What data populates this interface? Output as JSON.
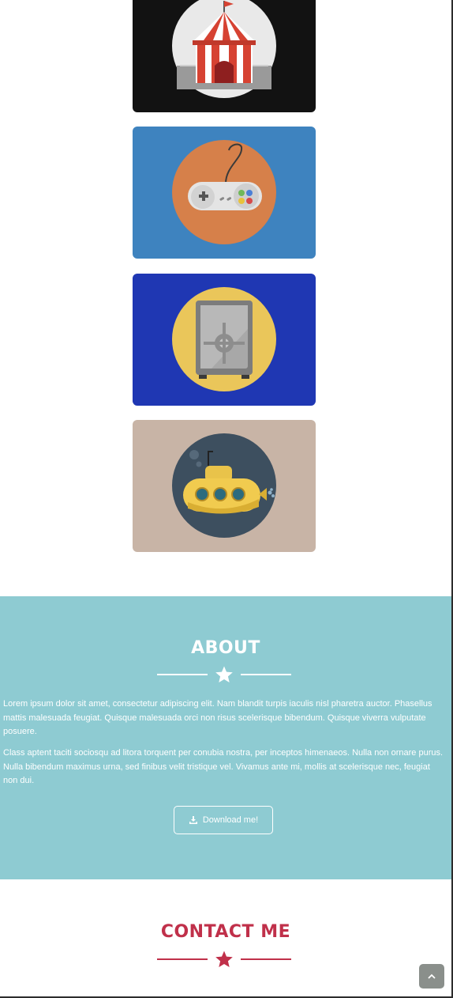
{
  "portfolio": {
    "items": [
      {
        "name": "circus-tent",
        "bg": "#121212",
        "circle": "#e9e9e9"
      },
      {
        "name": "game-controller",
        "bg": "#3e83bf",
        "circle": "#d6804a"
      },
      {
        "name": "safe",
        "bg": "#1f37b3",
        "circle": "#eac65a"
      },
      {
        "name": "submarine",
        "bg": "#c8b4a6",
        "circle": "#3d4f5f"
      }
    ]
  },
  "about": {
    "title": "ABOUT",
    "bg_color": "#8ecbd2",
    "paragraph_1": "Lorem ipsum dolor sit amet, consectetur adipiscing elit. Nam blandit turpis iaculis nisl pharetra auctor. Phasellus mattis malesuada feugiat. Quisque malesuada orci non risus scelerisque bibendum. Quisque viverra vulputate posuere.",
    "paragraph_2": "Class aptent taciti sociosqu ad litora torquent per conubia nostra, per inceptos himenaeos. Nulla non ornare purus. Nulla bibendum maximus urna, sed finibus velit tristique vel. Vivamus ante mi, mollis at scelerisque nec, feugiat non dui.",
    "download_label": "Download me!",
    "download_icon": "download-icon"
  },
  "contact": {
    "title": "CONTACT ME",
    "accent_color": "#c0304a"
  },
  "scroll_top": {
    "icon": "chevron-up-icon"
  }
}
